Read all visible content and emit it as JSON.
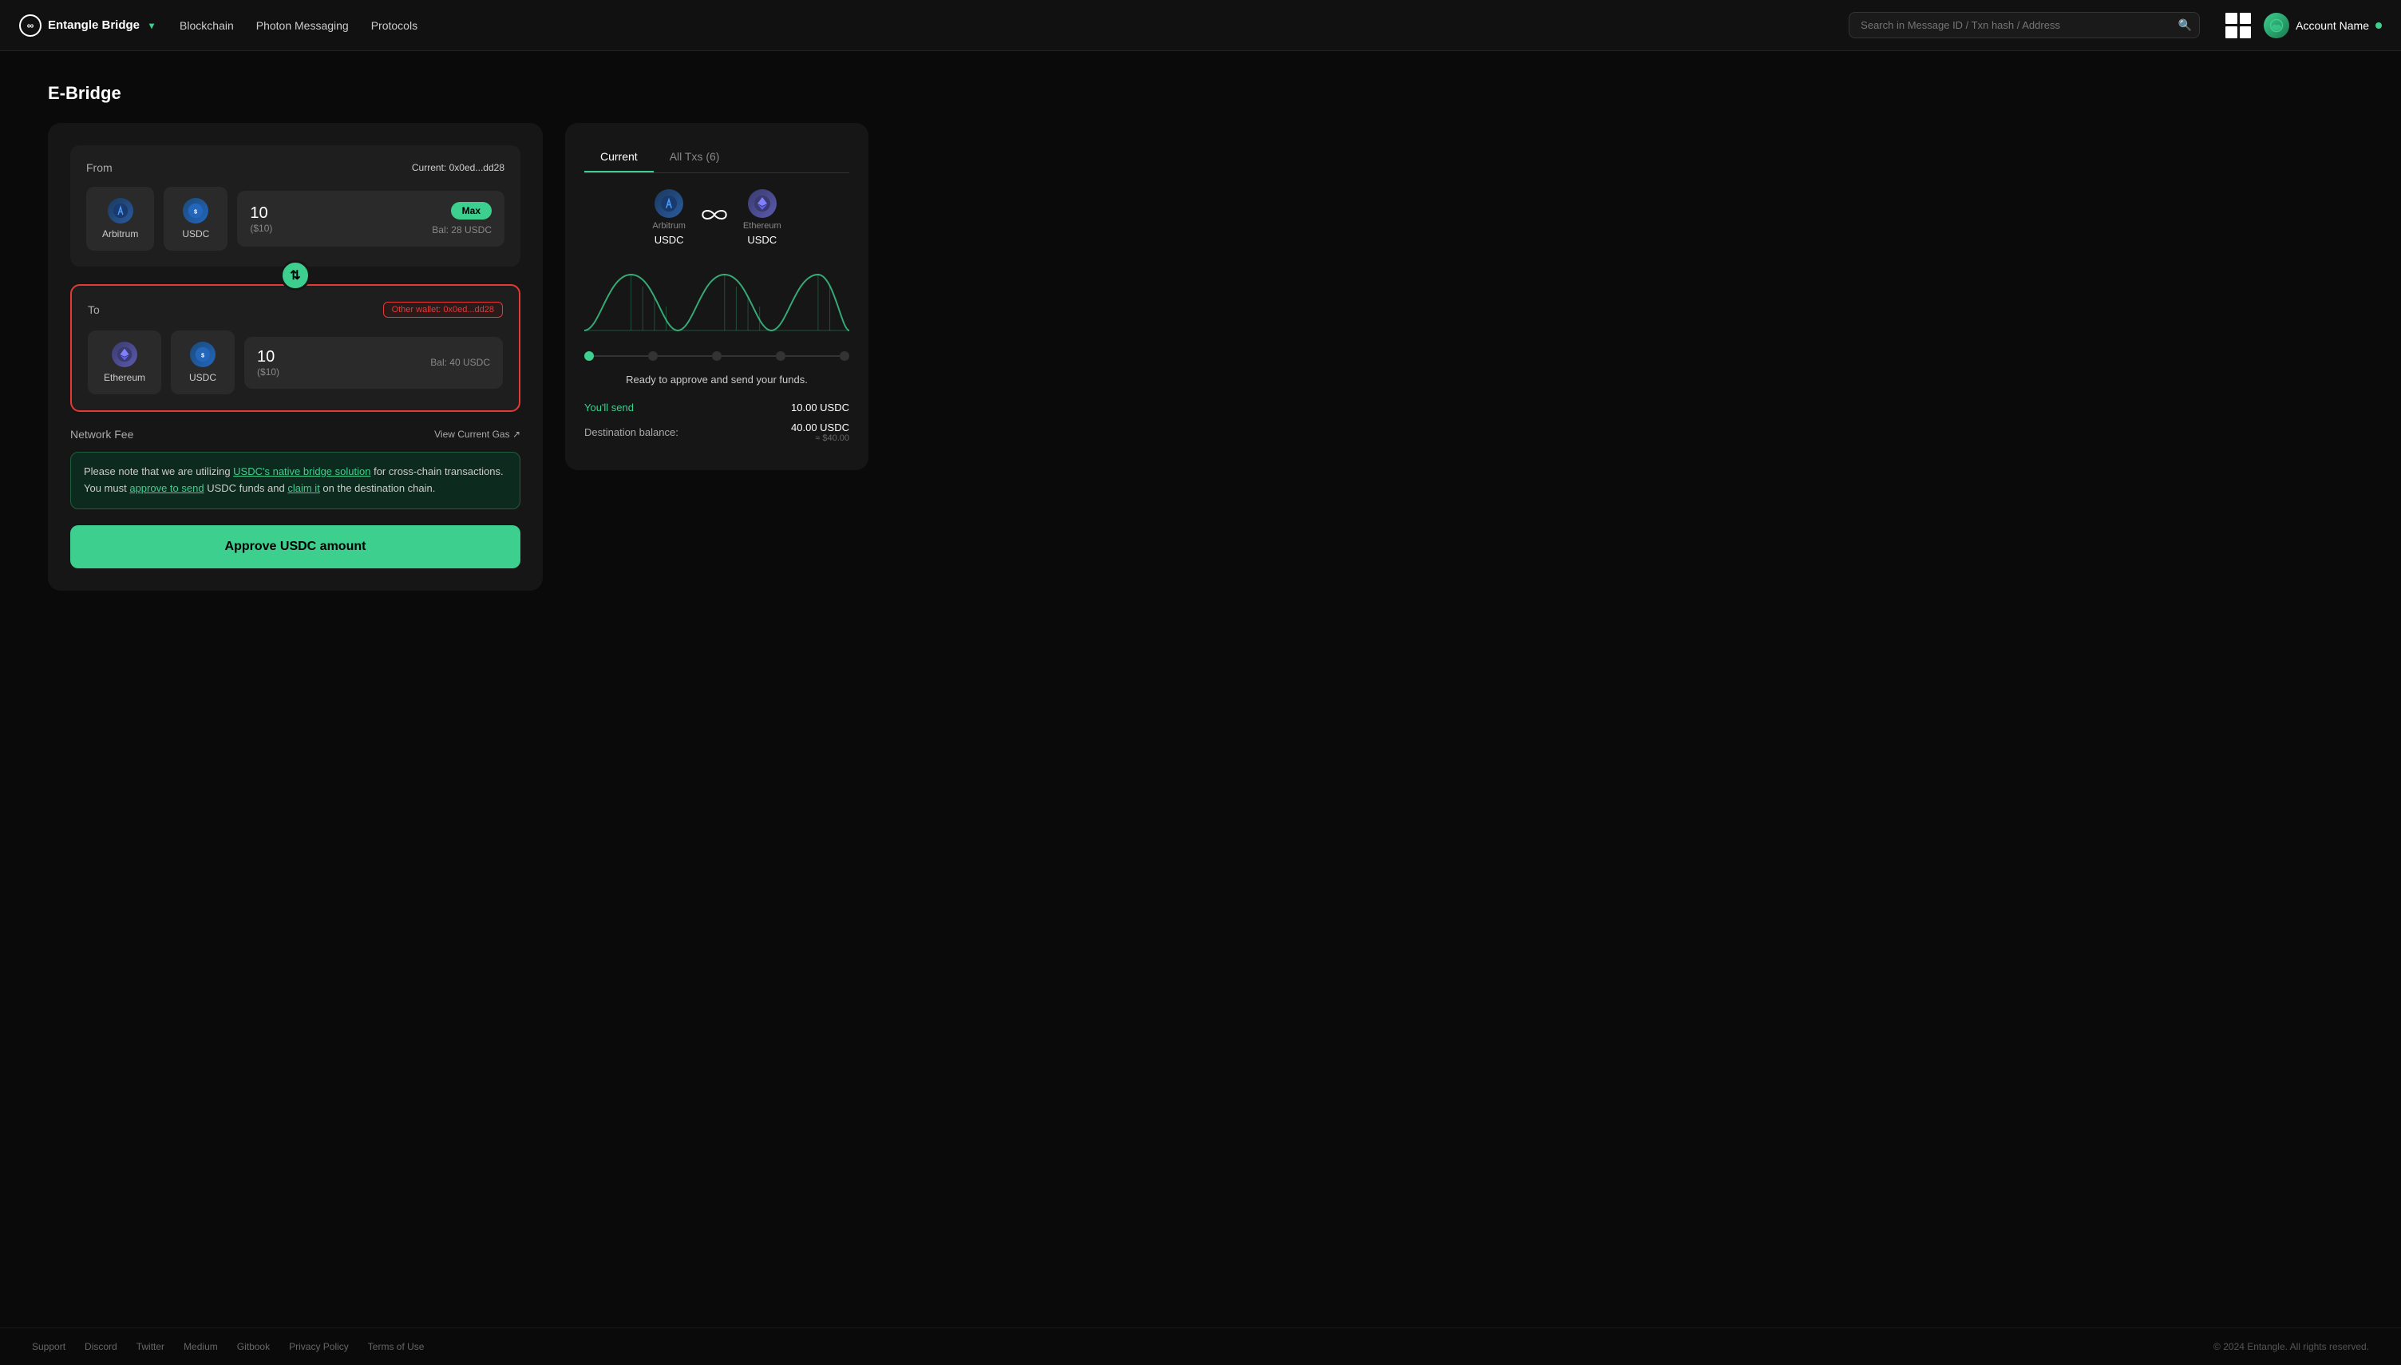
{
  "app": {
    "name": "Entangle Bridge",
    "logo_symbol": "∞"
  },
  "nav": {
    "links": [
      "Blockchain",
      "Photon Messaging",
      "Protocols"
    ],
    "search_placeholder": "Search in Message ID / Txn hash / Address",
    "account_name": "Account Name"
  },
  "page": {
    "title": "E-Bridge"
  },
  "bridge": {
    "from_label": "From",
    "current_wallet_label": "Current:",
    "current_wallet_address": "0x0ed...dd28",
    "from_chain": "Arbitrum",
    "from_token": "USDC",
    "from_amount": "10",
    "from_amount_usd": "($10)",
    "max_label": "Max",
    "bal_label": "Bal: 28 USDC",
    "to_label": "To",
    "other_wallet_label": "Other wallet:",
    "other_wallet_address": "0x0ed...dd28",
    "to_chain": "Ethereum",
    "to_token": "USDC",
    "to_amount": "10",
    "to_amount_usd": "($10)",
    "to_bal_label": "Bal: 40 USDC",
    "network_fee_label": "Network Fee",
    "view_gas_label": "View Current Gas ↗",
    "info_text_before": "Please note that we are utilizing ",
    "info_link1": "USDC's native bridge solution",
    "info_text_mid": " for cross-chain transactions. You must ",
    "info_link2": "approve to send",
    "info_text_mid2": " USDC funds and ",
    "info_link3": "claim it",
    "info_text_end": " on the destination chain.",
    "approve_btn_label": "Approve USDC amount"
  },
  "right_panel": {
    "tab_current": "Current",
    "tab_all_txs": "All Txs (6)",
    "from_chain_name": "Arbitrum",
    "from_token": "USDC",
    "to_chain_name": "Ethereum",
    "to_token": "USDC",
    "ready_text": "Ready to approve and send your funds.",
    "you_send_label": "You'll send",
    "you_send_value": "10.00 USDC",
    "dest_balance_label": "Destination balance:",
    "dest_balance_value": "40.00 USDC",
    "dest_balance_sub": "≈ $40.00"
  },
  "footer": {
    "links": [
      "Support",
      "Discord",
      "Twitter",
      "Medium",
      "Gitbook",
      "Privacy Policy",
      "Terms of Use"
    ],
    "copyright": "© 2024 Entangle. All rights reserved."
  }
}
